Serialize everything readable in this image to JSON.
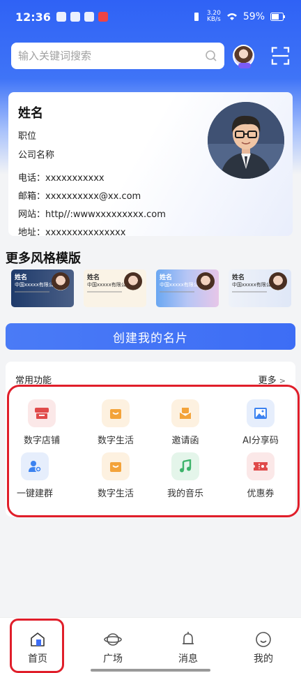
{
  "status_bar": {
    "time": "12:36",
    "net_speed_value": "3.20",
    "net_speed_unit": "KB/s",
    "battery": "59%"
  },
  "search": {
    "placeholder": "输入关键词搜索"
  },
  "card": {
    "name": "姓名",
    "position": "职位",
    "company": "公司名称",
    "phone": "电话：xxxxxxxxxxx",
    "email": "邮箱：xxxxxxxxxx@xx.com",
    "website": "网站：http//:wwwxxxxxxxxx.com",
    "address": "地址：xxxxxxxxxxxxxxx"
  },
  "templates_section": {
    "title": "更多风格模版",
    "items": [
      {
        "name": "姓名",
        "company": "中国xxxxx有限公司"
      },
      {
        "name": "姓名",
        "company": "中国xxxxx有限公司"
      },
      {
        "name": "姓名",
        "company": "中国xxxxx有限公司"
      },
      {
        "name": "姓名",
        "company": "中国xxxxx有限公司"
      }
    ]
  },
  "create_button": {
    "label": "创建我的名片"
  },
  "functions": {
    "title": "常用功能",
    "more": "更多",
    "items": [
      {
        "label": "数字店铺",
        "icon": "store-icon",
        "color": "#e04a4a",
        "bg": "#fbe8e8"
      },
      {
        "label": "数字生活",
        "icon": "shopping-bag-icon",
        "color": "#f3a33a",
        "bg": "#fdf1e0"
      },
      {
        "label": "邀请函",
        "icon": "invitation-icon",
        "color": "#f3a33a",
        "bg": "#fdf1e0"
      },
      {
        "label": "AI分享码",
        "icon": "image-icon",
        "color": "#3b82f0",
        "bg": "#e6eefc"
      },
      {
        "label": "一键建群",
        "icon": "group-icon",
        "color": "#3b82f0",
        "bg": "#e6eefc"
      },
      {
        "label": "数字生活",
        "icon": "shopping-bag-icon",
        "color": "#f3a33a",
        "bg": "#fdf1e0"
      },
      {
        "label": "我的音乐",
        "icon": "music-icon",
        "color": "#3cb36a",
        "bg": "#e4f5ea"
      },
      {
        "label": "优惠券",
        "icon": "coupon-icon",
        "color": "#e04a4a",
        "bg": "#fbe8e8"
      }
    ]
  },
  "tabbar": {
    "items": [
      {
        "label": "首页",
        "icon": "home-icon",
        "active": true
      },
      {
        "label": "广场",
        "icon": "planet-icon",
        "active": false
      },
      {
        "label": "消息",
        "icon": "bell-icon",
        "active": false
      },
      {
        "label": "我的",
        "icon": "profile-icon",
        "active": false
      }
    ]
  },
  "colors": {
    "brand": "#3d6df5",
    "highlight_outline": "#e01e2a"
  }
}
